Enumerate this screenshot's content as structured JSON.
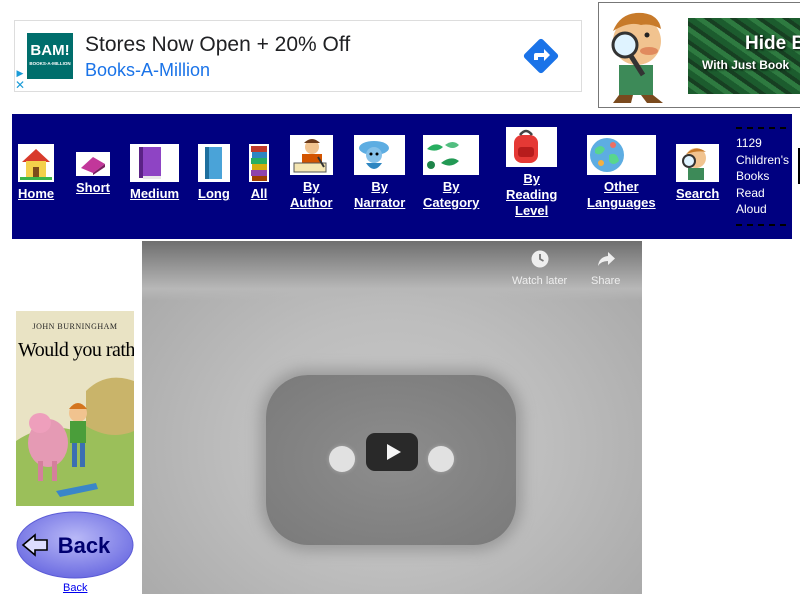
{
  "ad": {
    "logo_big": "BAM!",
    "logo_small": "BOOKS-A-MILLION",
    "title": "Stores Now Open + 20% Off",
    "subtitle": "Books-A-Million",
    "close_glyph": "✕",
    "brand_color": "#1a73e8"
  },
  "banner": {
    "line1": "Hide B",
    "line2": "With Just Book"
  },
  "nav": {
    "background": "#000080",
    "items": [
      {
        "label": "Home"
      },
      {
        "label": "Short"
      },
      {
        "label": "Medium"
      },
      {
        "label": "Long"
      },
      {
        "label": "All"
      },
      {
        "label_1": "By",
        "label_2": "Author"
      },
      {
        "label_1": "By",
        "label_2": "Narrator"
      },
      {
        "label_1": "By",
        "label_2": "Category"
      },
      {
        "label_1": "By",
        "label_2": "Reading",
        "label_3": "Level"
      },
      {
        "label_1": "Other",
        "label_2": "Languages"
      },
      {
        "label": "Search"
      }
    ],
    "count": {
      "line1": "1129",
      "line2": "Children's",
      "line3": "Books",
      "line4": "Read",
      "line5": "Aloud"
    }
  },
  "video": {
    "watch_later": "Watch later",
    "share": "Share"
  },
  "book": {
    "author": "JOHN BURNINGHAM",
    "title": "Would you rather..."
  },
  "back": {
    "button_label": "Back",
    "link_label": "Back"
  }
}
